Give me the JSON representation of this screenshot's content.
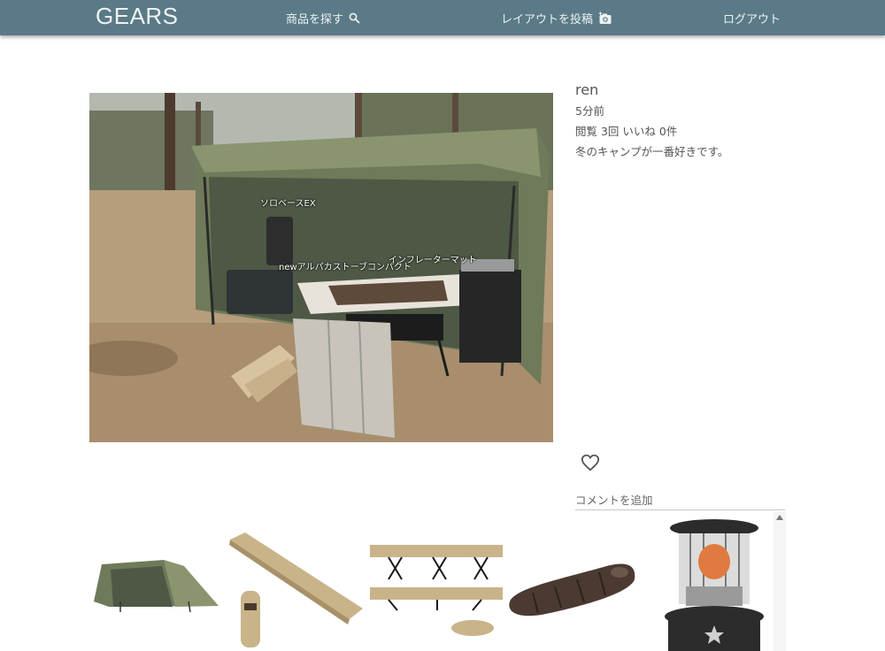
{
  "header": {
    "brand": "GEARS",
    "search_label": "商品を探す",
    "post_label": "レイアウトを投稿",
    "logout_label": "ログアウト"
  },
  "post": {
    "username": "ren",
    "time_ago": "5分前",
    "views_text": "閲覧 3回 いいね 0件",
    "caption": "冬のキャンプが一番好きです。",
    "tags": [
      {
        "label": "ソロベースEX"
      },
      {
        "label": "newアルパカストーブコンパクト"
      },
      {
        "label": "インフレーターマット"
      }
    ]
  },
  "comment": {
    "label": "コメントを追加"
  },
  "products": [
    {
      "name": "tent"
    },
    {
      "name": "inflator-mat"
    },
    {
      "name": "cot"
    },
    {
      "name": "sleeping-bag"
    },
    {
      "name": "kerosene-stove"
    }
  ],
  "colors": {
    "navbar": "#5a7a87",
    "tent": "#6f7a5a",
    "mat": "#c9b48a",
    "bag": "#4a3a32",
    "stove_body": "#2c2c2c"
  }
}
